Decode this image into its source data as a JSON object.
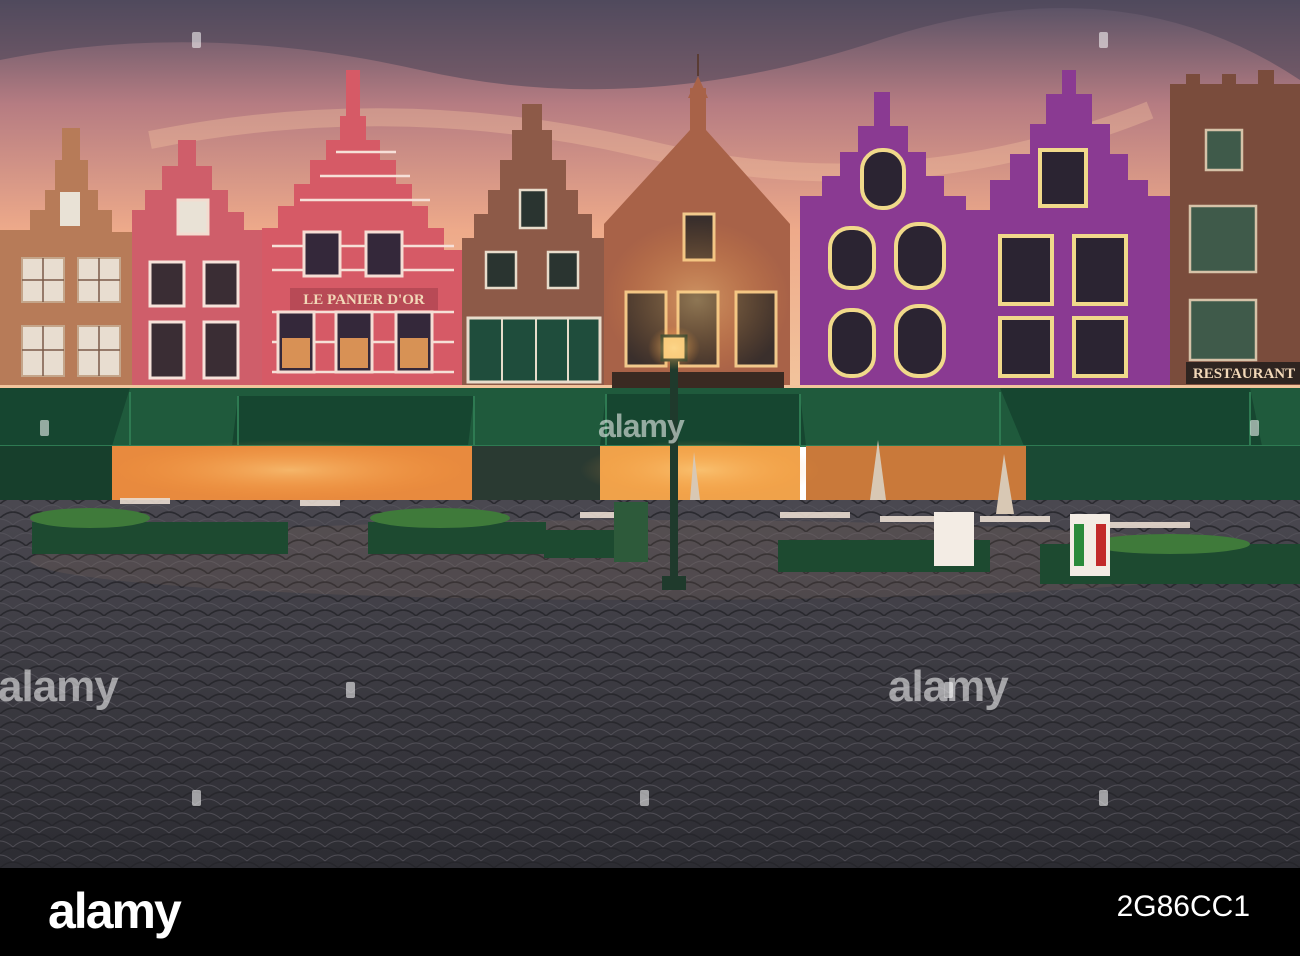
{
  "image": {
    "scene": "Market square with stepped-gable guild houses at dusk, green awnings, cobblestone foreground"
  },
  "storefront_signs": {
    "left": "LE PANIER D'OR",
    "right": "RESTAURANT"
  },
  "watermark": {
    "text": "alamy"
  },
  "footer": {
    "brand": "alamy",
    "image_id": "2G86CC1"
  },
  "colors": {
    "sky_top": "#4a4a5e",
    "sky_glow": "#f0b08a",
    "awning": "#1f5a3c",
    "cobble": "#3b3a3f",
    "bar": "#000000"
  }
}
